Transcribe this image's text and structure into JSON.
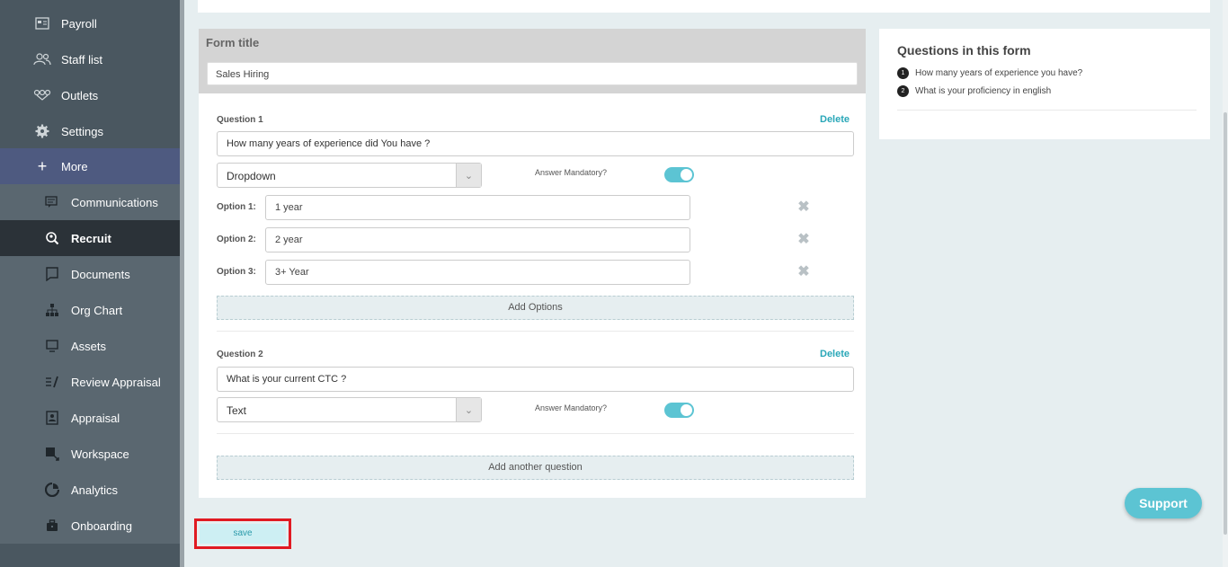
{
  "sidebar": {
    "items": [
      {
        "label": "Payroll",
        "icon": "payroll-icon"
      },
      {
        "label": "Staff list",
        "icon": "people-icon"
      },
      {
        "label": "Outlets",
        "icon": "outlets-icon"
      },
      {
        "label": "Settings",
        "icon": "gear-icon"
      },
      {
        "label": "More",
        "icon": "plus-icon"
      },
      {
        "label": "Communications",
        "icon": "chat-icon"
      },
      {
        "label": "Recruit",
        "icon": "search-icon"
      },
      {
        "label": "Documents",
        "icon": "document-icon"
      },
      {
        "label": "Org Chart",
        "icon": "org-chart-icon"
      },
      {
        "label": "Assets",
        "icon": "monitor-icon"
      },
      {
        "label": "Review Appraisal",
        "icon": "review-icon"
      },
      {
        "label": "Appraisal",
        "icon": "appraisal-icon"
      },
      {
        "label": "Workspace",
        "icon": "workspace-icon"
      },
      {
        "label": "Analytics",
        "icon": "analytics-icon"
      },
      {
        "label": "Onboarding",
        "icon": "briefcase-icon"
      }
    ]
  },
  "form": {
    "title_label": "Form title",
    "title_value": "Sales Hiring",
    "delete_label": "Delete",
    "mandatory_label": "Answer Mandatory?",
    "questions": [
      {
        "label": "Question 1",
        "text": "How many years of experience did You have ?",
        "type": "Dropdown",
        "mandatory": true,
        "options": [
          {
            "label": "Option 1:",
            "value": "1 year"
          },
          {
            "label": "Option 2:",
            "value": "2 year"
          },
          {
            "label": "Option 3:",
            "value": "3+ Year"
          }
        ],
        "add_options_label": "Add Options"
      },
      {
        "label": "Question 2",
        "text": "What is your current CTC ?",
        "type": "Text",
        "mandatory": true
      }
    ],
    "add_question_label": "Add another question",
    "save_label": "save"
  },
  "questions_panel": {
    "title": "Questions in this form",
    "items": [
      {
        "num": "1",
        "text": "How many years of experience you have?"
      },
      {
        "num": "2",
        "text": "What is your proficiency in english"
      }
    ]
  },
  "support_label": "Support",
  "colors": {
    "accent": "#5cc4d3",
    "sidebar": "#4a5760",
    "highlight": "#e01a22"
  }
}
